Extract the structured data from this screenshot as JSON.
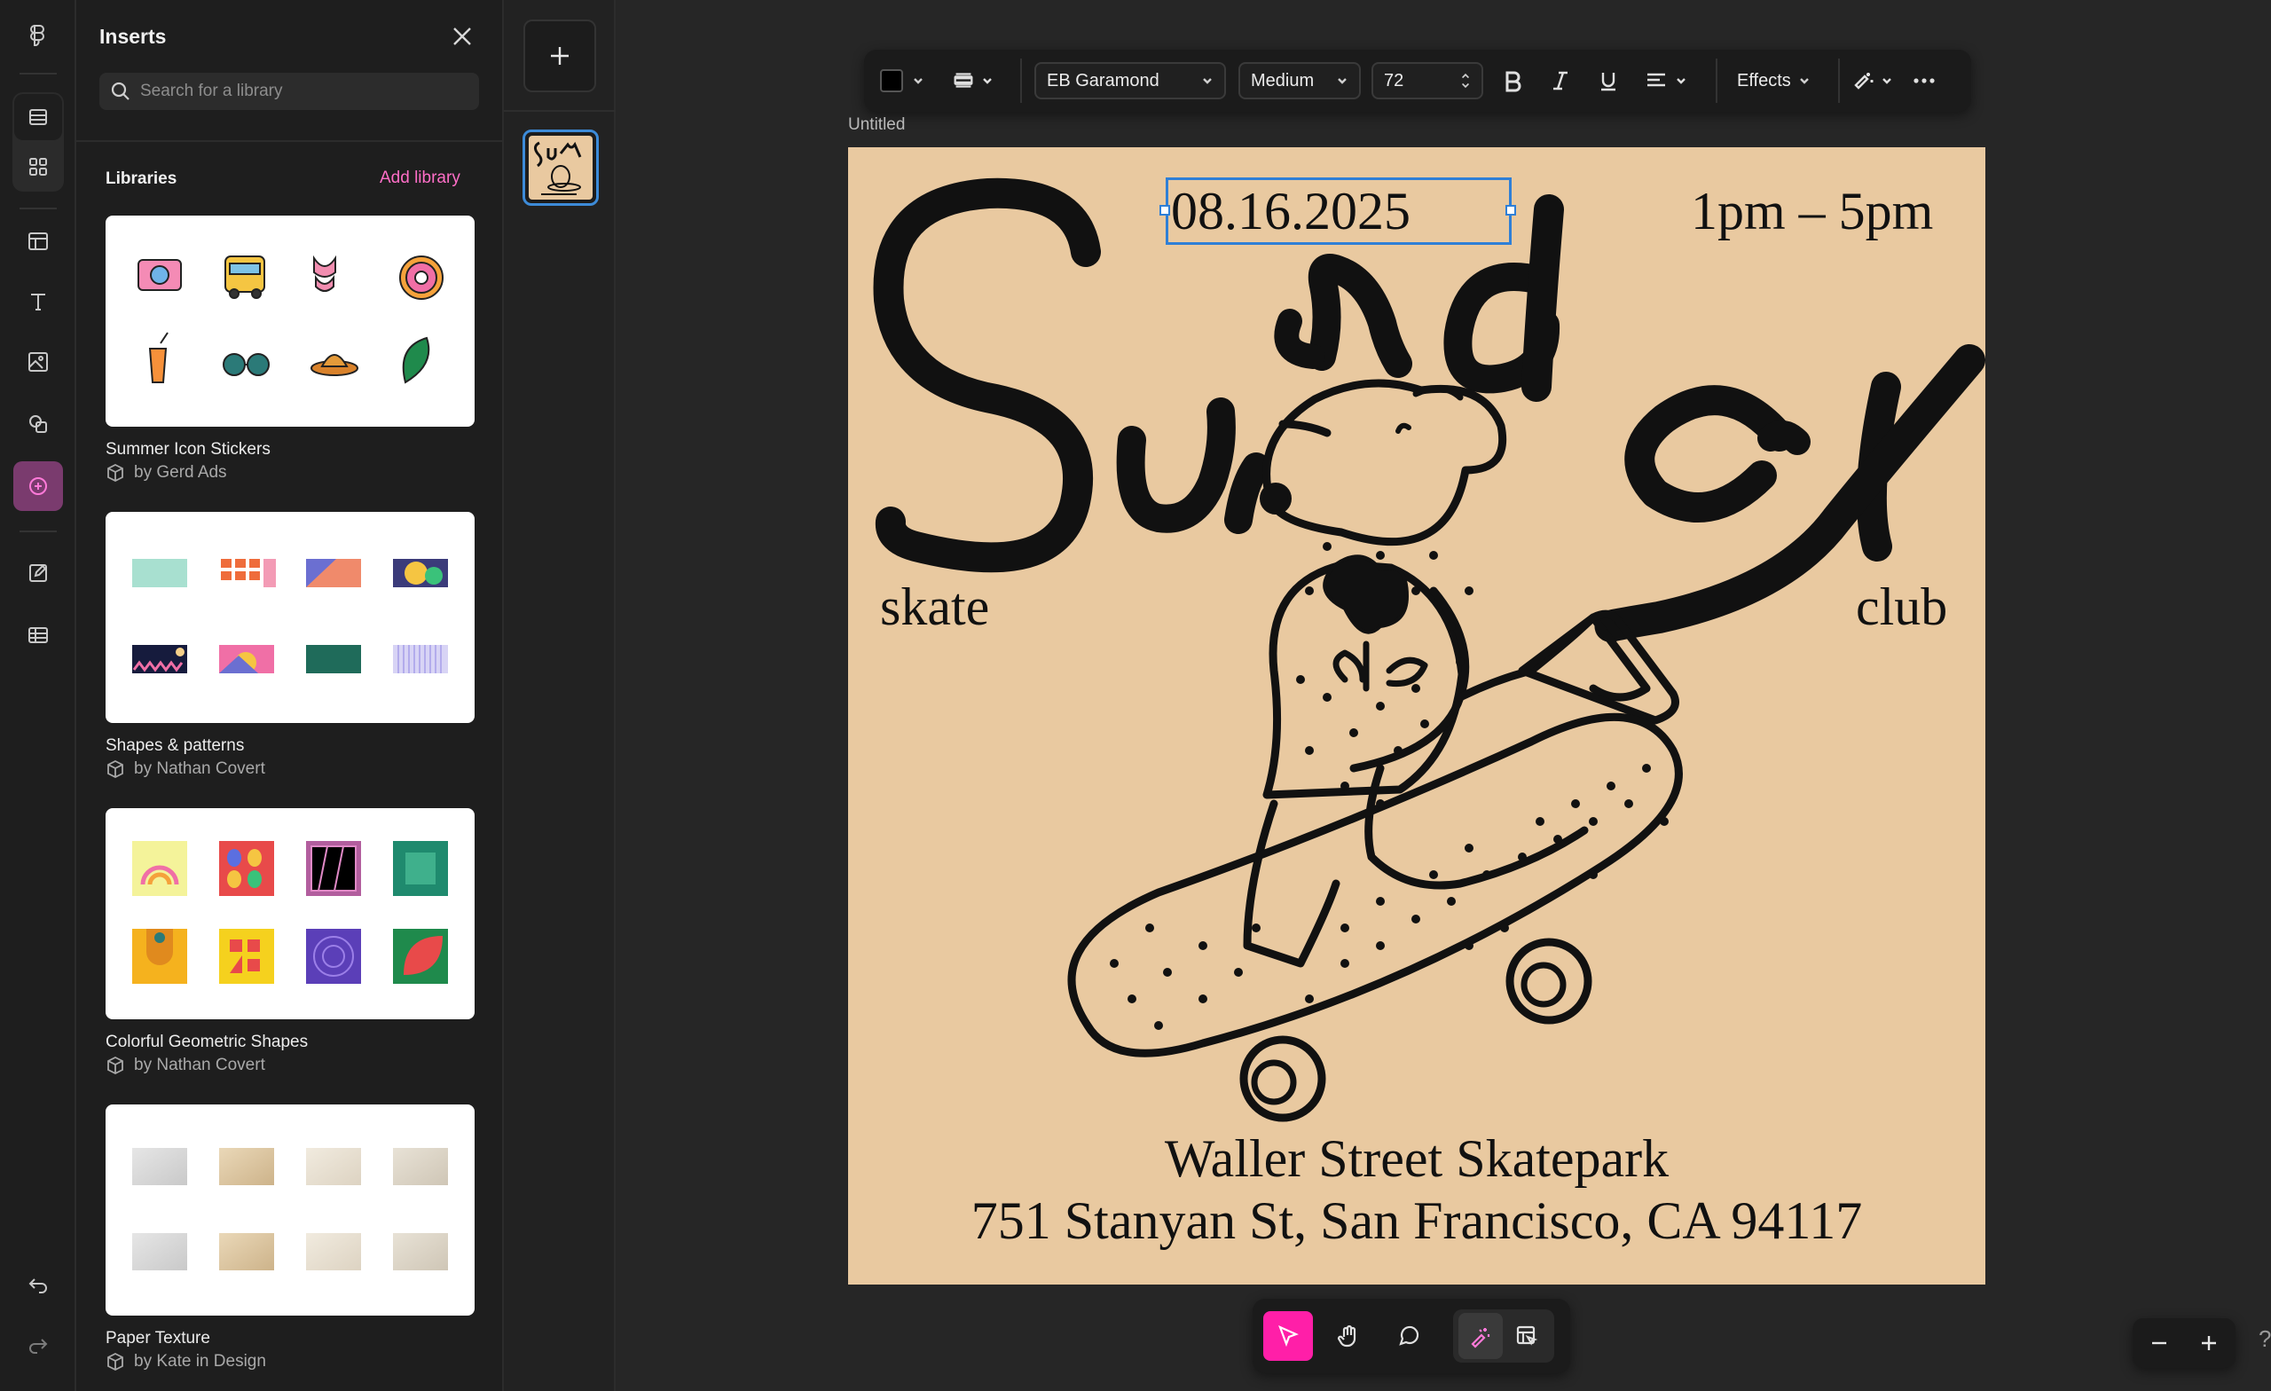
{
  "rail": {
    "items": [
      "logo",
      "layers",
      "assets",
      "layout",
      "text",
      "image",
      "shapes",
      "inserts",
      "edit",
      "table",
      "undo",
      "redo"
    ]
  },
  "inserts_panel": {
    "title": "Inserts",
    "search_placeholder": "Search for a library",
    "libraries_heading": "Libraries",
    "add_library_label": "Add library",
    "libraries": [
      {
        "name": "Summer Icon Stickers",
        "author": "by Gerd Ads"
      },
      {
        "name": "Shapes & patterns",
        "author": "by Nathan Covert"
      },
      {
        "name": "Colorful Geometric Shapes",
        "author": "by Nathan Covert"
      },
      {
        "name": "Paper Texture",
        "author": "by Kate in Design"
      }
    ]
  },
  "toolbar": {
    "font_family": "EB Garamond",
    "font_weight": "Medium",
    "font_size": "72",
    "effects_label": "Effects",
    "text_color": "#000000"
  },
  "canvas": {
    "document_title": "Untitled",
    "poster": {
      "date": "08.16.2025",
      "time": "1pm – 5pm",
      "headline": "Sunday",
      "left_word": "skate",
      "right_word": "club",
      "venue": "Waller Street Skatepark",
      "address": "751 Stanyan St, San Francisco, CA 94117",
      "background": "#e9c9a0"
    }
  },
  "colors": {
    "accent": "#ff1fa8",
    "link": "#ff6ec7",
    "selection": "#2f7fd6"
  }
}
